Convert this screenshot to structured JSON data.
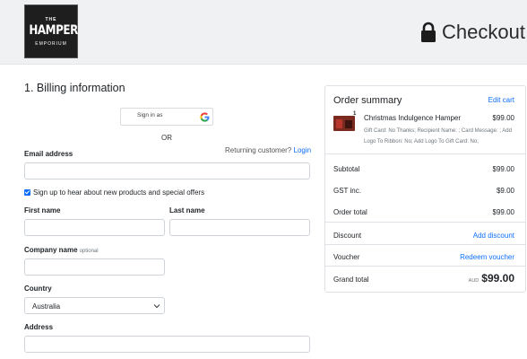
{
  "header": {
    "logo": {
      "line1": "THE",
      "line2": "HAMPER",
      "line3": "EMPORIUM"
    },
    "title": "Checkout",
    "icon": "lock-icon"
  },
  "billing": {
    "heading": "1. Billing information",
    "google_button": "Sign in as",
    "or": "OR",
    "returning_text": "Returning customer?",
    "login_link": "Login",
    "email_label": "Email address",
    "newsletter_label": "Sign up to hear about new products and special offers",
    "newsletter_checked": true,
    "first_name_label": "First name",
    "last_name_label": "Last name",
    "company_label": "Company name",
    "company_optional": "optional",
    "country_label": "Country",
    "country_value": "Australia",
    "address_label": "Address"
  },
  "summary": {
    "heading": "Order summary",
    "edit_cart": "Edit cart",
    "item": {
      "qty": "1",
      "name": "Christmas Indulgence Hamper",
      "price": "$99.00",
      "description": "Gift Card: No Thanks; Recipient Name: ; Card Message: ; Add Logo To Ribbon: No; Add Logo To Gift Card: No;"
    },
    "subtotal_label": "Subtotal",
    "subtotal_value": "$99.00",
    "gst_label": "GST inc.",
    "gst_value": "$9.00",
    "order_total_label": "Order total",
    "order_total_value": "$99.00",
    "discount_label": "Discount",
    "discount_link": "Add discount",
    "voucher_label": "Voucher",
    "voucher_link": "Redeem voucher",
    "grand_total_label": "Grand total",
    "currency": "AUD",
    "grand_total_value": "$99.00"
  },
  "colors": {
    "link": "#0d6efd",
    "header_bg": "#f0f1f3"
  }
}
